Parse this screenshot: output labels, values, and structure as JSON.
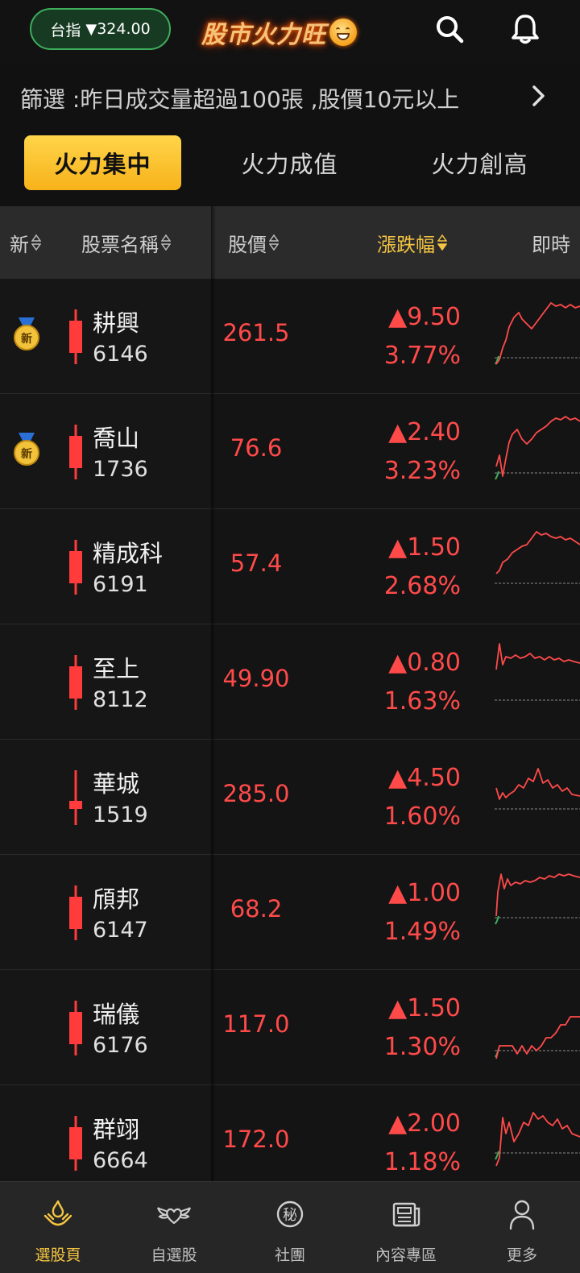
{
  "header": {
    "index_label": "台指",
    "index_value": "324.00",
    "index_direction": "down",
    "app_title": "股市火力旺"
  },
  "filter": {
    "text": "篩選 :昨日成交量超過100張 ,股價10元以上"
  },
  "tabs": [
    {
      "label": "火力集中",
      "active": true
    },
    {
      "label": "火力成值",
      "active": false
    },
    {
      "label": "火力創高",
      "active": false
    }
  ],
  "columns": {
    "new": "新",
    "name": "股票名稱",
    "price": "股價",
    "change": "漲跌幅",
    "realtime": "即時"
  },
  "medal_label": "新",
  "colors": {
    "up": "#ff4a4a",
    "down": "#3fae5c",
    "accent": "#f5c542",
    "background": "#111111"
  },
  "stocks": [
    {
      "name": "耕興",
      "code": "6146",
      "price": "261.5",
      "change": "▲9.50",
      "pct": "3.77%",
      "is_new": true,
      "candle": "red"
    },
    {
      "name": "喬山",
      "code": "1736",
      "price": "76.6",
      "change": "▲2.40",
      "pct": "3.23%",
      "is_new": true,
      "candle": "red"
    },
    {
      "name": "精成科",
      "code": "6191",
      "price": "57.4",
      "change": "▲1.50",
      "pct": "2.68%",
      "is_new": false,
      "candle": "red"
    },
    {
      "name": "至上",
      "code": "8112",
      "price": "49.90",
      "change": "▲0.80",
      "pct": "1.63%",
      "is_new": false,
      "candle": "red"
    },
    {
      "name": "華城",
      "code": "1519",
      "price": "285.0",
      "change": "▲4.50",
      "pct": "1.60%",
      "is_new": false,
      "candle": "red-small"
    },
    {
      "name": "頎邦",
      "code": "6147",
      "price": "68.2",
      "change": "▲1.00",
      "pct": "1.49%",
      "is_new": false,
      "candle": "red"
    },
    {
      "name": "瑞儀",
      "code": "6176",
      "price": "117.0",
      "change": "▲1.50",
      "pct": "1.30%",
      "is_new": false,
      "candle": "red"
    },
    {
      "name": "群翊",
      "code": "6664",
      "price": "172.0",
      "change": "▲2.00",
      "pct": "1.18%",
      "is_new": false,
      "candle": "red"
    }
  ],
  "nav": [
    {
      "label": "選股頁",
      "icon": "flame-hand-icon",
      "active": true
    },
    {
      "label": "自選股",
      "icon": "winged-heart-icon",
      "active": false
    },
    {
      "label": "社團",
      "icon": "secret-badge-icon",
      "active": false
    },
    {
      "label": "內容專區",
      "icon": "newspaper-icon",
      "active": false
    },
    {
      "label": "更多",
      "icon": "person-icon",
      "active": false
    }
  ],
  "nav_secret_glyph": "秘"
}
